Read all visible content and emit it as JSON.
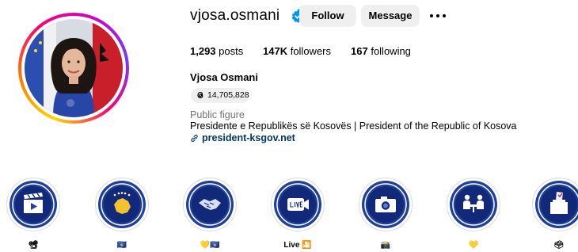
{
  "profile": {
    "username": "vjosa.osmani",
    "verified": true,
    "full_name": "Vjosa Osmani",
    "threads_count": "14,705,828",
    "category": "Public figure",
    "bio": "Presidente e Republikës së Kosovës | President of the Republic of Kosova",
    "link": "president-ksgov.net"
  },
  "actions": {
    "follow_label": "Follow",
    "message_label": "Message"
  },
  "stats": {
    "posts": {
      "value": "1,293",
      "label": "posts"
    },
    "followers": {
      "value": "147K",
      "label": "followers"
    },
    "following": {
      "value": "167",
      "label": "following"
    }
  },
  "highlights": [
    {
      "label": "📽",
      "icon": "clapperboard-icon"
    },
    {
      "label": "🇽🇰",
      "icon": "kosovo-map-icon"
    },
    {
      "label": "💛🇽🇰",
      "icon": "handshake-icon"
    },
    {
      "label": "Live 🎦",
      "icon": "live-camera-icon"
    },
    {
      "label": "📸",
      "icon": "camera-icon"
    },
    {
      "label": "💛",
      "icon": "people-meeting-icon"
    },
    {
      "label": "🗳",
      "icon": "ballot-box-icon"
    }
  ],
  "colors": {
    "highlight_blue": "#1f3f9c",
    "highlight_blue_dark": "#12297a",
    "verified_blue": "#0095f6",
    "link_color": "#00376b",
    "secondary_text": "#737373",
    "button_bg": "#efefef"
  }
}
